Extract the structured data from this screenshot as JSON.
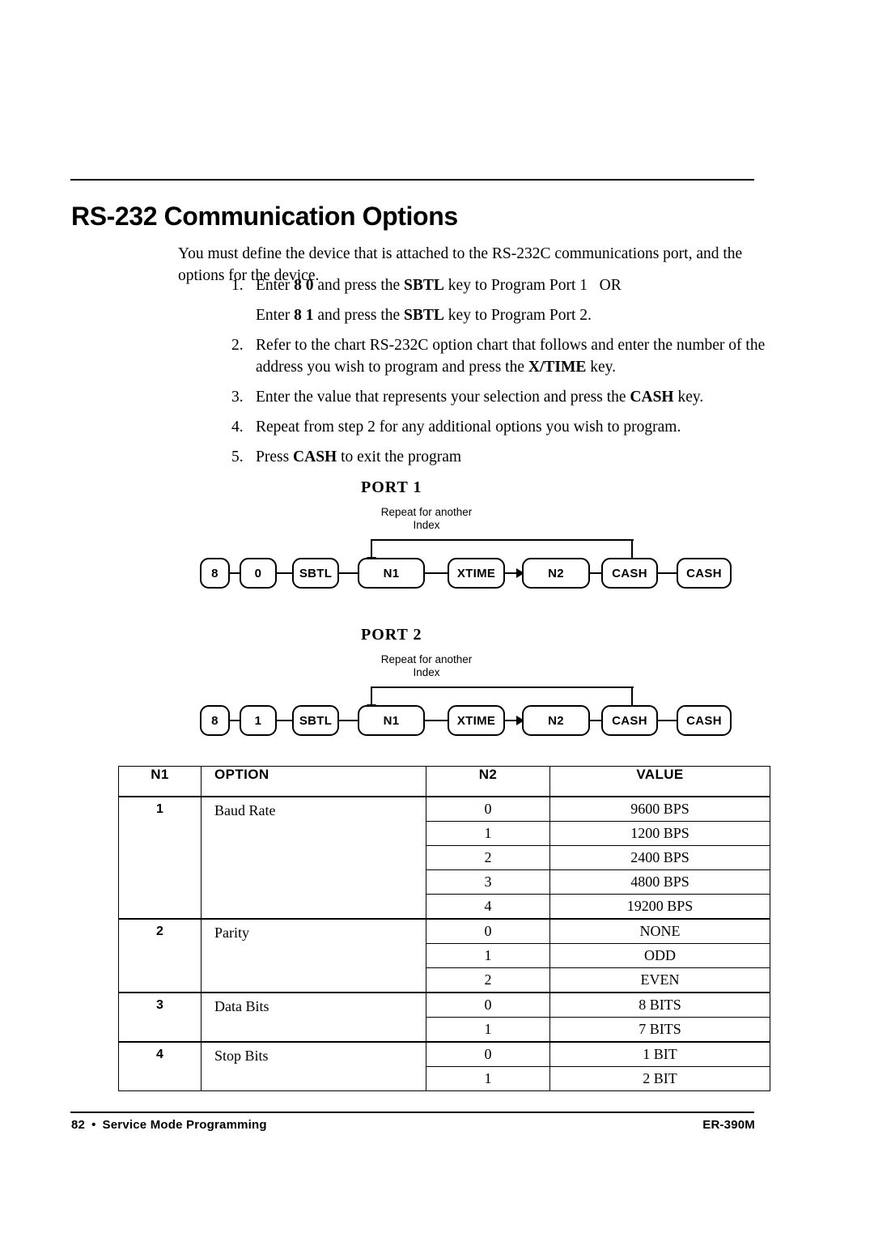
{
  "document": {
    "title": "RS-232 Communication Options",
    "intro": "You must define the device that is attached to the RS-232C communications port, and the options for the device."
  },
  "steps": [
    {
      "num": "1.",
      "html": "Enter <b>8 0</b> and press the <b>SBTL</b> key to Program Port 1&nbsp;&nbsp; OR"
    },
    {
      "num": "",
      "html": "Enter <b>8 1</b> and press the <b>SBTL</b> key to Program Port 2."
    },
    {
      "num": "2.",
      "html": "Refer to the chart RS-232C option chart that follows and enter the number of the address you wish to program and press the <b>X/TIME</b> key."
    },
    {
      "num": "3.",
      "html": "Enter the value that represents your selection and press the <b>CASH</b> key."
    },
    {
      "num": "4.",
      "html": "Repeat from step 2 for any additional options you wish to program."
    },
    {
      "num": "5.",
      "html": "Press <b>CASH</b> to exit the program"
    }
  ],
  "diagrams": [
    {
      "title": "PORT 1",
      "loop_label_line1": "Repeat for another",
      "loop_label_line2": "Index",
      "nodes": [
        "8",
        "0",
        "SBTL",
        "N1",
        "XTIME",
        "N2",
        "CASH",
        "CASH"
      ]
    },
    {
      "title": "PORT 2",
      "loop_label_line1": "Repeat for another",
      "loop_label_line2": "Index",
      "nodes": [
        "8",
        "1",
        "SBTL",
        "N1",
        "XTIME",
        "N2",
        "CASH",
        "CASH"
      ]
    }
  ],
  "table": {
    "headers": [
      "N1",
      "OPTION",
      "N2",
      "VALUE"
    ],
    "groups": [
      {
        "n1": "1",
        "option": "Baud Rate",
        "rows": [
          {
            "n2": "0",
            "value": "9600 BPS"
          },
          {
            "n2": "1",
            "value": "1200 BPS"
          },
          {
            "n2": "2",
            "value": "2400 BPS"
          },
          {
            "n2": "3",
            "value": "4800 BPS"
          },
          {
            "n2": "4",
            "value": "19200 BPS"
          }
        ]
      },
      {
        "n1": "2",
        "option": "Parity",
        "rows": [
          {
            "n2": "0",
            "value": "NONE"
          },
          {
            "n2": "1",
            "value": "ODD"
          },
          {
            "n2": "2",
            "value": "EVEN"
          }
        ]
      },
      {
        "n1": "3",
        "option": "Data Bits",
        "rows": [
          {
            "n2": "0",
            "value": "8 BITS"
          },
          {
            "n2": "1",
            "value": "7 BITS"
          }
        ]
      },
      {
        "n1": "4",
        "option": "Stop Bits",
        "rows": [
          {
            "n2": "0",
            "value": "1 BIT"
          },
          {
            "n2": "1",
            "value": "2 BIT"
          }
        ]
      }
    ]
  },
  "footer": {
    "page_number": "82",
    "bullet": "•",
    "section": "Service Mode Programming",
    "model": "ER-390M"
  }
}
